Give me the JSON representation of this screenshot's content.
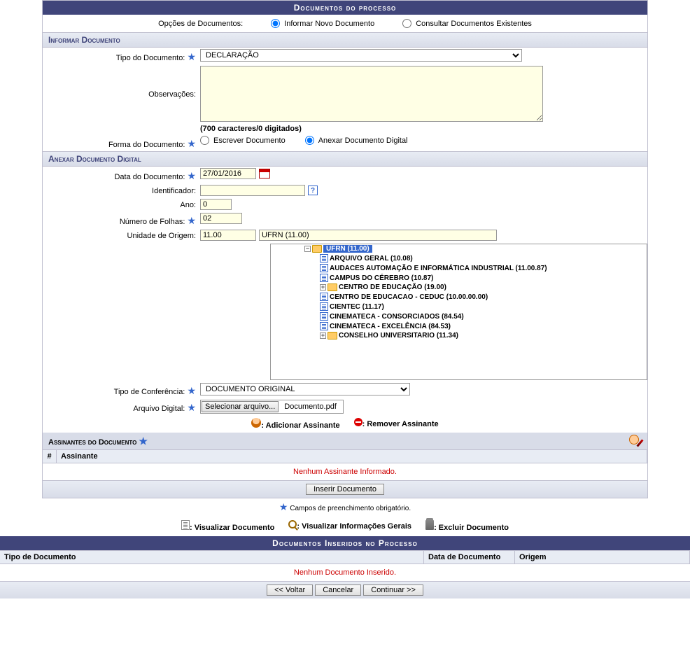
{
  "panel_title": "Documentos do processo",
  "options_label": "Opções de Documentos:",
  "opt_new": "Informar Novo Documento",
  "opt_query": "Consultar Documentos Existentes",
  "section_informar": "Informar Documento",
  "tipo_doc_label": "Tipo do Documento:",
  "tipo_doc_value": "DECLARAÇÃO",
  "obs_label": "Observações:",
  "obs_hint": "(700 caracteres/0 digitados)",
  "forma_label": "Forma do Documento:",
  "forma_escrever": "Escrever Documento",
  "forma_anexar": "Anexar Documento Digital",
  "section_anexar": "Anexar Documento Digital",
  "data_doc_label": "Data do Documento:",
  "data_doc_value": "27/01/2016",
  "ident_label": "Identificador:",
  "ano_label": "Ano:",
  "ano_value": "0",
  "folhas_label": "Número de Folhas:",
  "folhas_value": "02",
  "unidade_label": "Unidade de Origem:",
  "unidade_code": "11.00",
  "unidade_name": "UFRN (11.00)",
  "tree": {
    "root": "UFRN (11.00)",
    "children": [
      "ARQUIVO GERAL (10.08)",
      "AUDACES AUTOMAÇÃO E INFORMÁTICA INDUSTRIAL (11.00.87)",
      "CAMPUS DO CÉREBRO (10.87)",
      "CENTRO DE EDUCAÇÃO (19.00)",
      "CENTRO DE EDUCACAO - CEDUC (10.00.00.00)",
      "CIENTEC (11.17)",
      "CINEMATECA - CONSORCIADOS (84.54)",
      "CINEMATECA - EXCELÊNCIA (84.53)",
      "CONSELHO UNIVERSITARIO (11.34)"
    ]
  },
  "conf_label": "Tipo de Conferência:",
  "conf_value": "DOCUMENTO ORIGINAL",
  "arquivo_label": "Arquivo Digital:",
  "arquivo_btn": "Selecionar arquivo...",
  "arquivo_file": "Documento.pdf",
  "add_assinante": ": Adicionar Assinante",
  "rem_assinante": ": Remover Assinante",
  "assinantes_title": "Assinantes do Documento",
  "col_num": "#",
  "col_assinante": "Assinante",
  "no_assinante": "Nenhum Assinante Informado.",
  "btn_inserir": "Inserir Documento",
  "required_note": "Campos de preenchimento obrigatório.",
  "action_view_doc": ": Visualizar Documento",
  "action_view_info": ": Visualizar Informações Gerais",
  "action_delete": ": Excluir Documento",
  "inserted_title": "Documentos Inseridos no Processo",
  "col_tipo": "Tipo de Documento",
  "col_data": "Data de Documento",
  "col_origem": "Origem",
  "no_doc": "Nenhum Documento Inserido.",
  "btn_voltar": "<< Voltar",
  "btn_cancelar": "Cancelar",
  "btn_continuar": "Continuar >>"
}
